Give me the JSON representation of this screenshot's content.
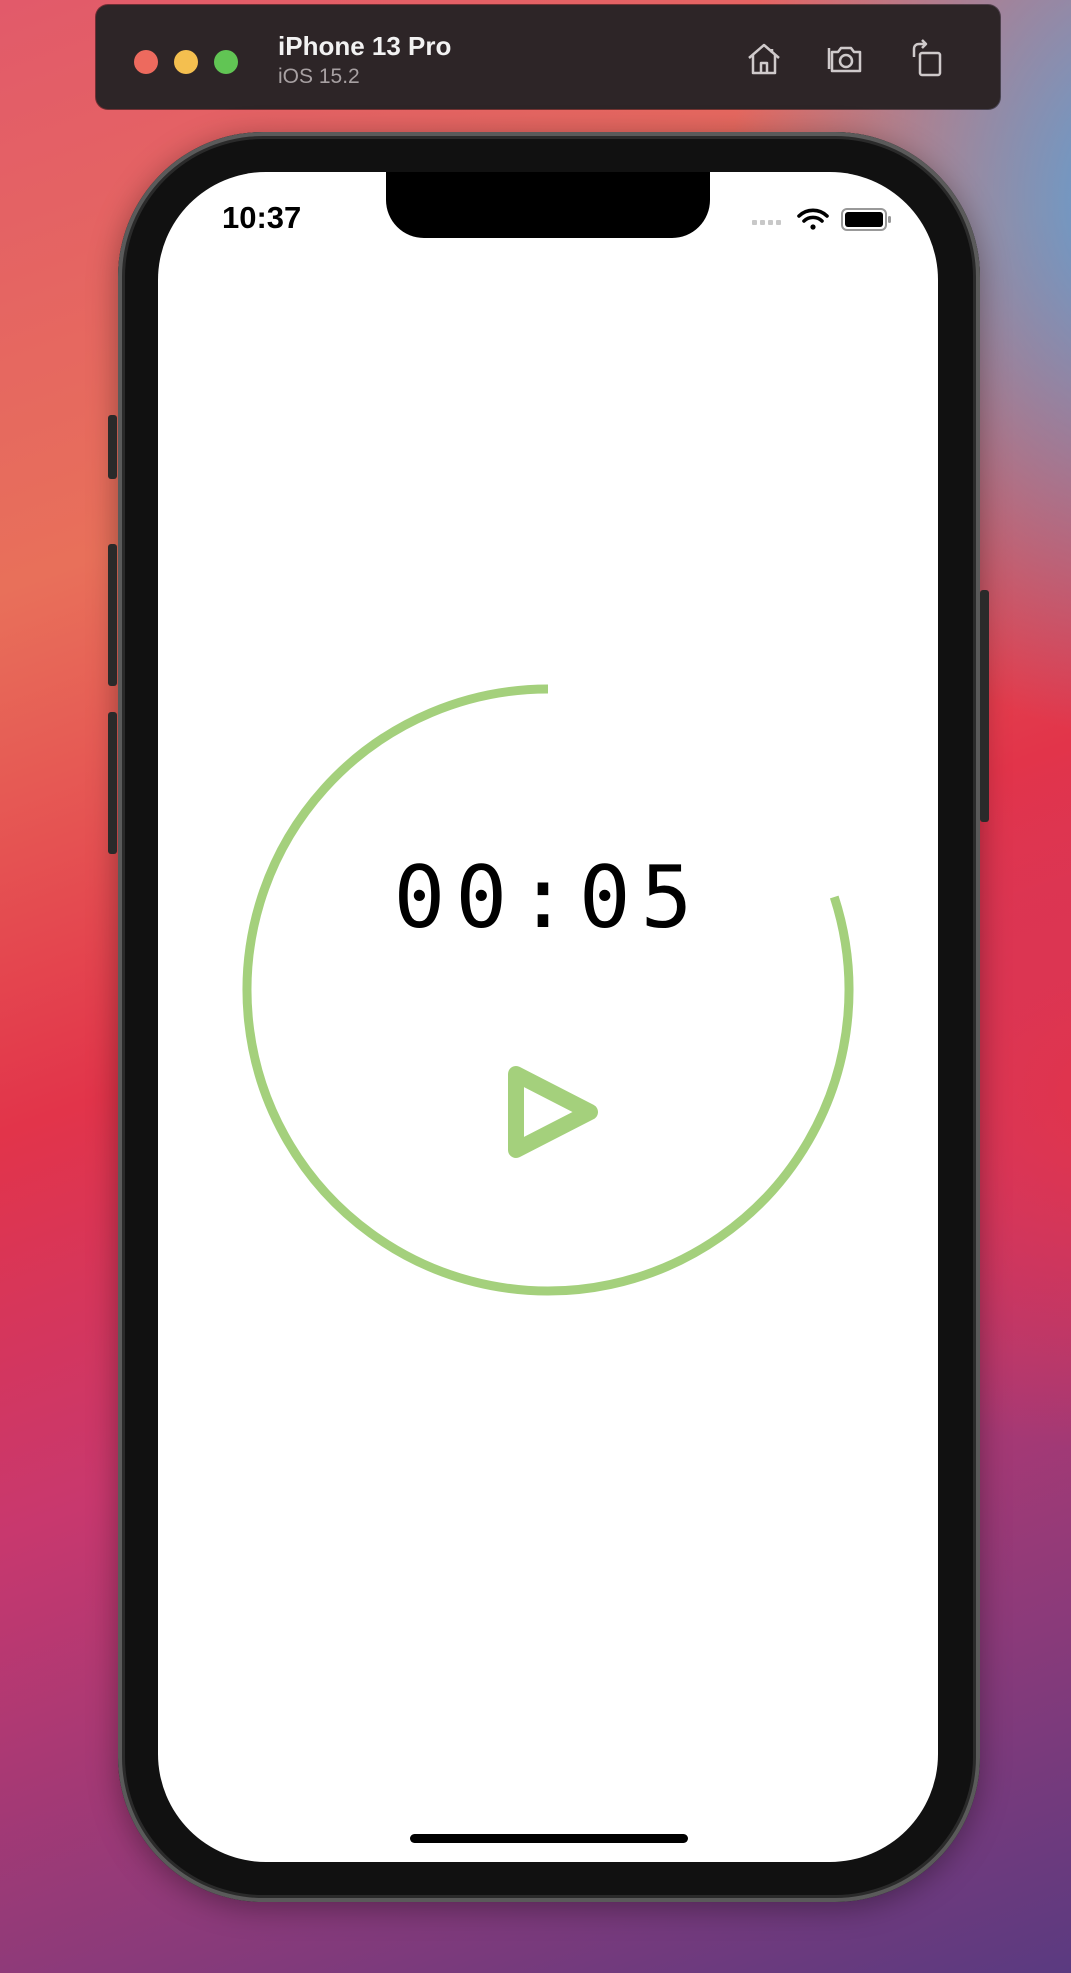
{
  "simulator": {
    "device_name": "iPhone 13 Pro",
    "os_version": "iOS 15.2",
    "tools": [
      "home-icon",
      "screenshot-icon",
      "rotate-icon"
    ]
  },
  "status_bar": {
    "time": "10:37"
  },
  "timer": {
    "display": "00:05",
    "progress": 0.8,
    "accent_color": "#a4d07c"
  },
  "colors": {
    "accent": "#a4d07c",
    "toolbar_bg": "#2d2527"
  }
}
